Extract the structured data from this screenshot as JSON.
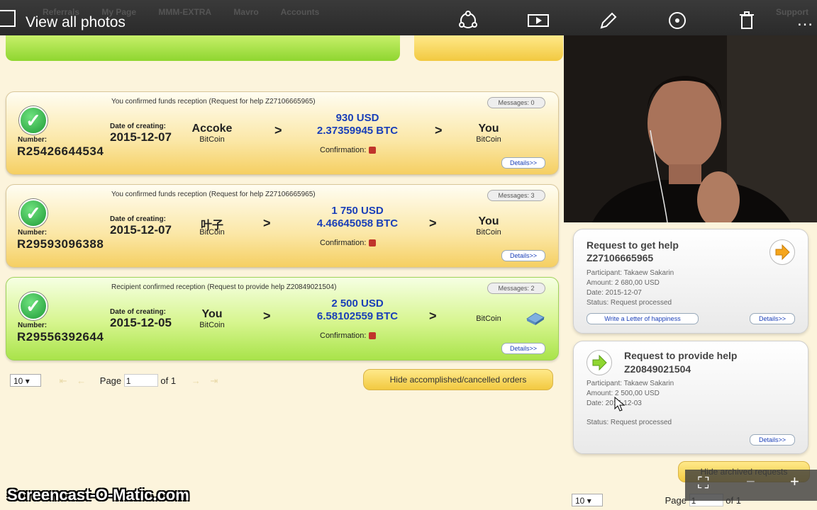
{
  "topbar": {
    "title": "View all photos",
    "bg_nav": [
      "Referrals",
      "My Page",
      "MMM-EXTRA",
      "Mavro",
      "Accounts",
      "Support"
    ],
    "icons": [
      "share-icon",
      "slideshow-icon",
      "edit-icon",
      "sync-icon",
      "delete-icon",
      "more-icon"
    ]
  },
  "cards": [
    {
      "header": "You confirmed funds reception (Request for help Z27106665965)",
      "messages": "Messages: 0",
      "number_label": "Number:",
      "number": "R25426644534",
      "date_label": "Date of creating:",
      "date": "2015-12-07",
      "sender": "Accoke",
      "sender_sub": "BitCoin",
      "usd": "930 USD",
      "btc": "2.37359945 BTC",
      "confirmation": "Confirmation:",
      "receiver": "You",
      "receiver_sub": "BitCoin",
      "details": "Details>>",
      "style": "yellow"
    },
    {
      "header": "You confirmed funds reception (Request for help Z27106665965)",
      "messages": "Messages: 3",
      "number_label": "Number:",
      "number": "R29593096388",
      "date_label": "Date of creating:",
      "date": "2015-12-07",
      "sender": "叶子",
      "sender_sub": "BitCoin",
      "usd": "1 750 USD",
      "btc": "4.46645058 BTC",
      "confirmation": "Confirmation:",
      "receiver": "You",
      "receiver_sub": "BitCoin",
      "details": "Details>>",
      "style": "yellow"
    },
    {
      "header": "Recipient confirmed reception (Request to provide help Z20849021504)",
      "messages": "Messages: 2",
      "number_label": "Number:",
      "number": "R29556392644",
      "date_label": "Date of creating:",
      "date": "2015-12-05",
      "sender": "You",
      "sender_sub": "BitCoin",
      "usd": "2 500 USD",
      "btc": "6.58102559 BTC",
      "confirmation": "Confirmation:",
      "receiver": "",
      "receiver_sub": "BitCoin",
      "details": "Details>>",
      "style": "green"
    }
  ],
  "pager": {
    "per_page": "10",
    "page_label": "Page",
    "page_value": "1",
    "of_label": "of 1",
    "hide_button": "Hide accomplished/cancelled orders"
  },
  "side": {
    "get_help": {
      "title": "Request to get help",
      "id": "Z27106665965",
      "participant": "Participant: Takaew Sakarin",
      "amount": "Amount: 2 680,00 USD",
      "date": "Date: 2015-12-07",
      "status": "Status: Request processed",
      "letter_button": "Write a Letter of happiness",
      "details": "Details>>"
    },
    "provide_help": {
      "title": "Request to provide help",
      "id": "Z20849021504",
      "participant": "Participant: Takaew Sakarin",
      "amount": "Amount: 2 500,00 USD",
      "date": "Date: 2015-12-03",
      "status": "Status: Request processed",
      "details": "Details>>"
    },
    "hide_archived": "Hide archived requests",
    "per_page": "10",
    "page_label": "Page",
    "page_value": "1",
    "of_label": "of 1"
  },
  "watermark": "Screencast-O-Matic.com",
  "colors": {
    "page_bg": "#fcf4dc",
    "amount_blue": "#1a3fb8",
    "accent_yellow": "#f2c940",
    "accent_green": "#a9e34a"
  }
}
